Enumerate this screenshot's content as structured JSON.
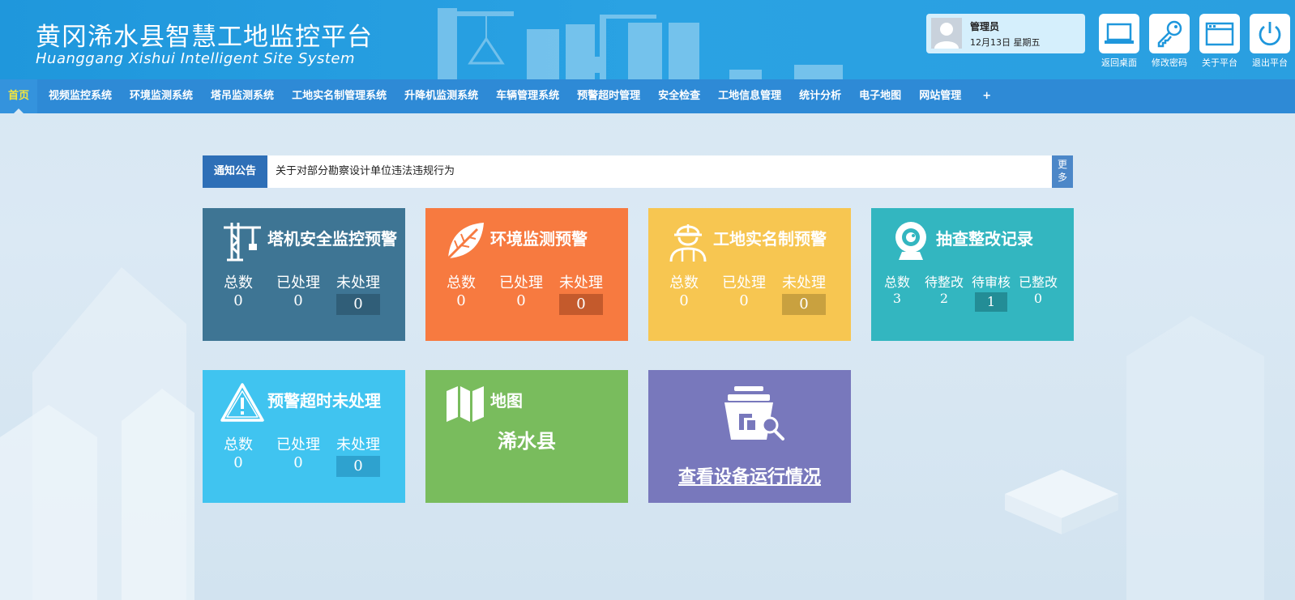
{
  "header": {
    "title_cn": "黄冈浠水县智慧工地监控平台",
    "title_en": "Huanggang Xishui Intelligent Site System",
    "user": {
      "name": "管理员",
      "date": "12月13日  星期五"
    },
    "buttons": [
      {
        "label": "返回桌面",
        "icon": "monitor-icon"
      },
      {
        "label": "修改密码",
        "icon": "key-icon"
      },
      {
        "label": "关于平台",
        "icon": "window-icon"
      },
      {
        "label": "退出平台",
        "icon": "power-icon"
      }
    ]
  },
  "nav": {
    "items": [
      "首页",
      "视频监控系统",
      "环境监测系统",
      "塔吊监测系统",
      "工地实名制管理系统",
      "升降机监测系统",
      "车辆管理系统",
      "预警超时管理",
      "安全检查",
      "工地信息管理",
      "统计分析",
      "电子地图",
      "网站管理",
      "+"
    ],
    "active_index": 0
  },
  "notice": {
    "tag": "通知公告",
    "text": "关于对部分勘察设计单位违法违规行为",
    "more": "更多"
  },
  "cards": {
    "tower": {
      "title": "塔机安全监控预警",
      "icon": "tower-crane-icon",
      "stats": [
        {
          "k": "总数",
          "v": "0"
        },
        {
          "k": "已处理",
          "v": "0"
        },
        {
          "k": "未处理",
          "v": "0"
        }
      ]
    },
    "env": {
      "title": "环境监测预警",
      "icon": "leaf-icon",
      "stats": [
        {
          "k": "总数",
          "v": "0"
        },
        {
          "k": "已处理",
          "v": "0"
        },
        {
          "k": "未处理",
          "v": "0"
        }
      ]
    },
    "realname": {
      "title": "工地实名制预警",
      "icon": "worker-icon",
      "stats": [
        {
          "k": "总数",
          "v": "0"
        },
        {
          "k": "已处理",
          "v": "0"
        },
        {
          "k": "未处理",
          "v": "0"
        }
      ]
    },
    "check": {
      "title": "抽查整改记录",
      "icon": "camera-icon",
      "stats": [
        {
          "k": "总数",
          "v": "3"
        },
        {
          "k": "待整改",
          "v": "2"
        },
        {
          "k": "待审核",
          "v": "1"
        },
        {
          "k": "已整改",
          "v": "0"
        }
      ]
    },
    "timeout": {
      "title": "预警超时未处理",
      "icon": "warning-icon",
      "stats": [
        {
          "k": "总数",
          "v": "0"
        },
        {
          "k": "已处理",
          "v": "0"
        },
        {
          "k": "未处理",
          "v": "0"
        }
      ]
    },
    "map": {
      "title": "地图",
      "icon": "map-icon",
      "sub": "浠水县"
    },
    "device": {
      "icon": "device-search-icon",
      "sub": "查看设备运行情况"
    }
  },
  "colors": {
    "header": "#1f97dc",
    "nav": "#2e8ad6",
    "nav_active_text": "#f5e63d",
    "tower": "#3e7594",
    "env": "#f77a40",
    "realname": "#f7c651",
    "check": "#33b6c0",
    "timeout": "#40c4f0",
    "map": "#79bc5d",
    "device": "#7878bc"
  }
}
